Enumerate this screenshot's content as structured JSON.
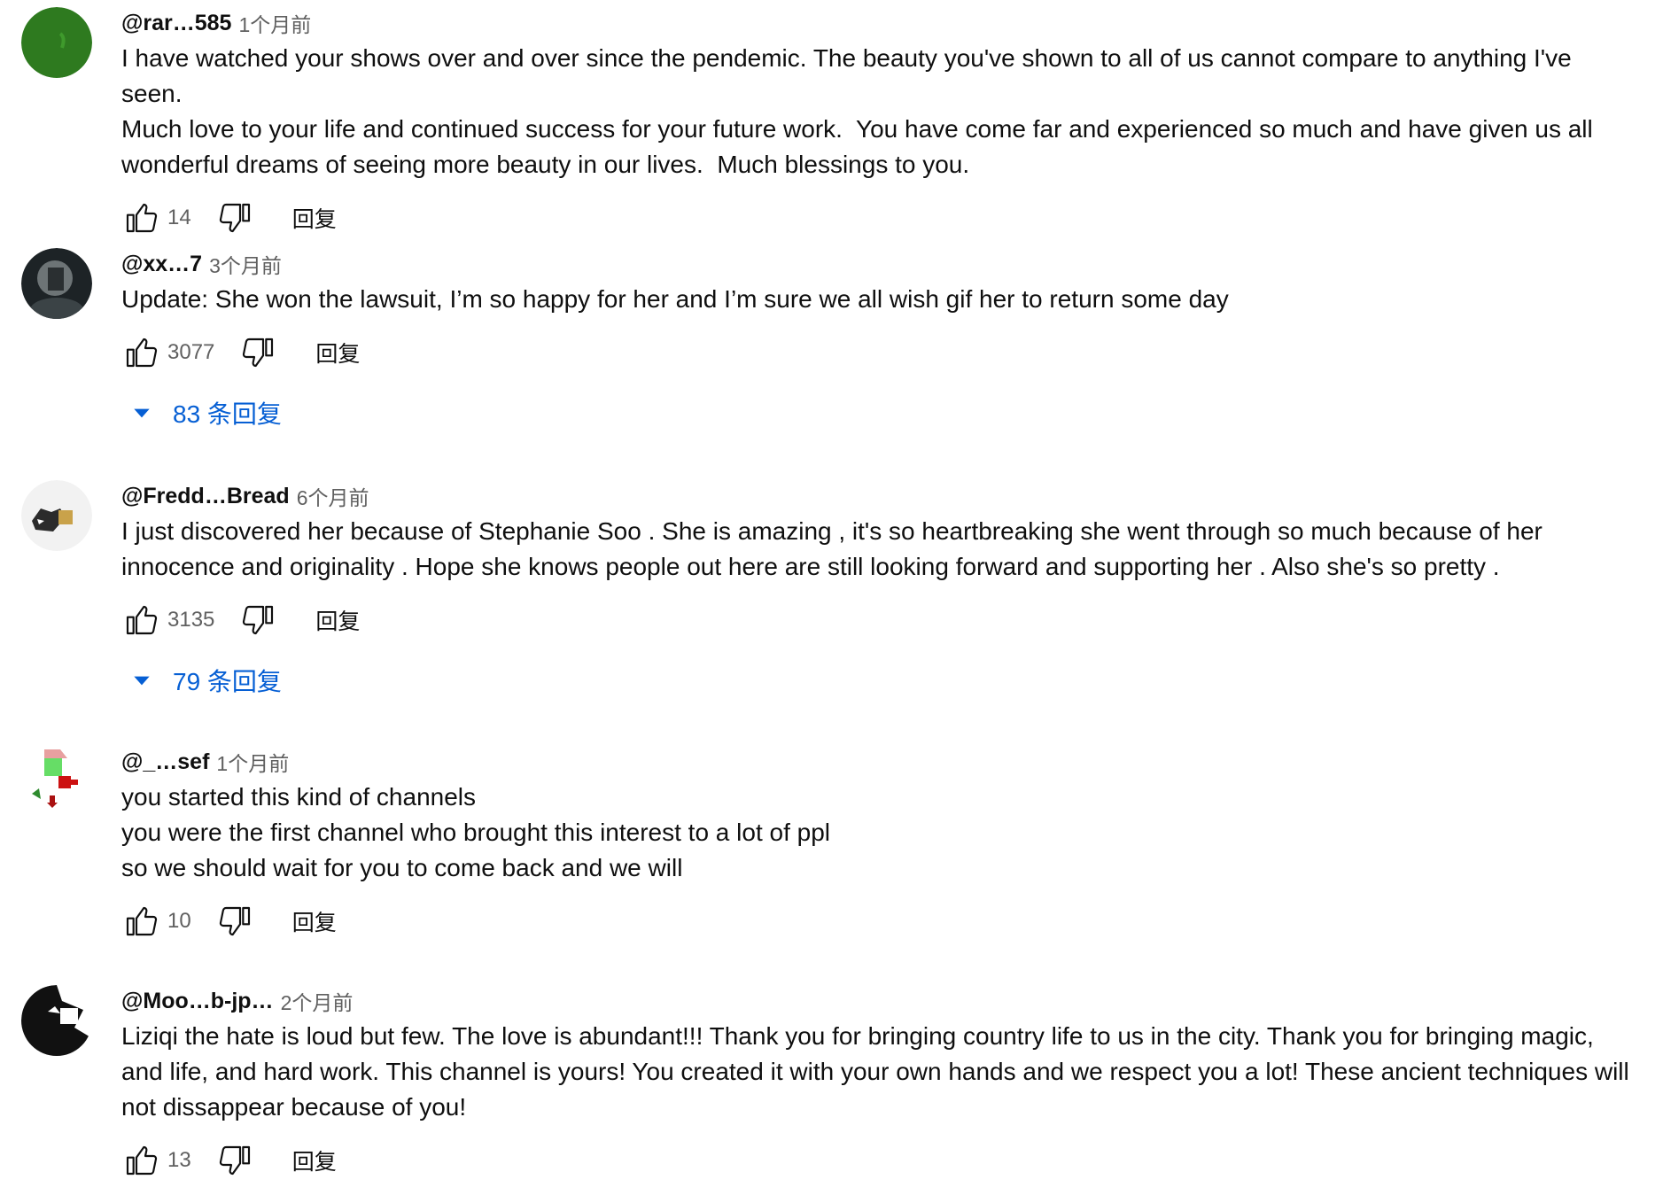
{
  "comments": [
    {
      "author": "@rar…585",
      "time": "1个月前",
      "text": "I have watched your shows over and over since the pendemic. The beauty you've shown to all of us cannot compare to anything I've seen.\nMuch love to your life and continued success for your future work.  You have come far and experienced so much and have given us all\nwonderful dreams of seeing more beauty in our lives.  Much blessings to you.",
      "likes": "14",
      "reply_label": "回复",
      "avatar_icon": "green-circle-avatar-icon"
    },
    {
      "author": "@xx…7",
      "time": "3个月前",
      "text": "Update: She won the lawsuit, I’m so happy for her and I’m sure we all wish gif her to return some day",
      "likes": "3077",
      "reply_label": "回复",
      "replies_label": "83 条回复",
      "avatar_icon": "dark-photo-avatar-icon"
    },
    {
      "author": "@Fredd…Bread",
      "time": "6个月前",
      "text": "I just discovered her because of Stephanie Soo . She is amazing , it's so heartbreaking she went through so much because of her\ninnocence and originality . Hope she knows people out here are still looking forward and supporting her . Also she's so pretty .",
      "likes": "3135",
      "reply_label": "回复",
      "replies_label": "79 条回复",
      "avatar_icon": "cat-avatar-icon"
    },
    {
      "author": "@_…sef",
      "time": "1个月前",
      "text": "you started this kind of channels\nyou were the first channel who brought this interest to a lot of ppl\nso we should wait for you to come back and we will",
      "likes": "10",
      "reply_label": "回复",
      "avatar_icon": "pixel-flag-avatar-icon"
    },
    {
      "author": "@Moo…b-jp…",
      "time": "2个月前",
      "text": "Liziqi the hate is loud but few. The love is abundant!!! Thank you for bringing country life to us in the city. Thank you for bringing magic,\nand life, and hard work. This channel is yours! You created it with your own hands and we respect you a lot! These ancient techniques will\nnot dissappear because of you!",
      "likes": "13",
      "reply_label": "回复",
      "avatar_icon": "bw-art-avatar-icon"
    }
  ]
}
